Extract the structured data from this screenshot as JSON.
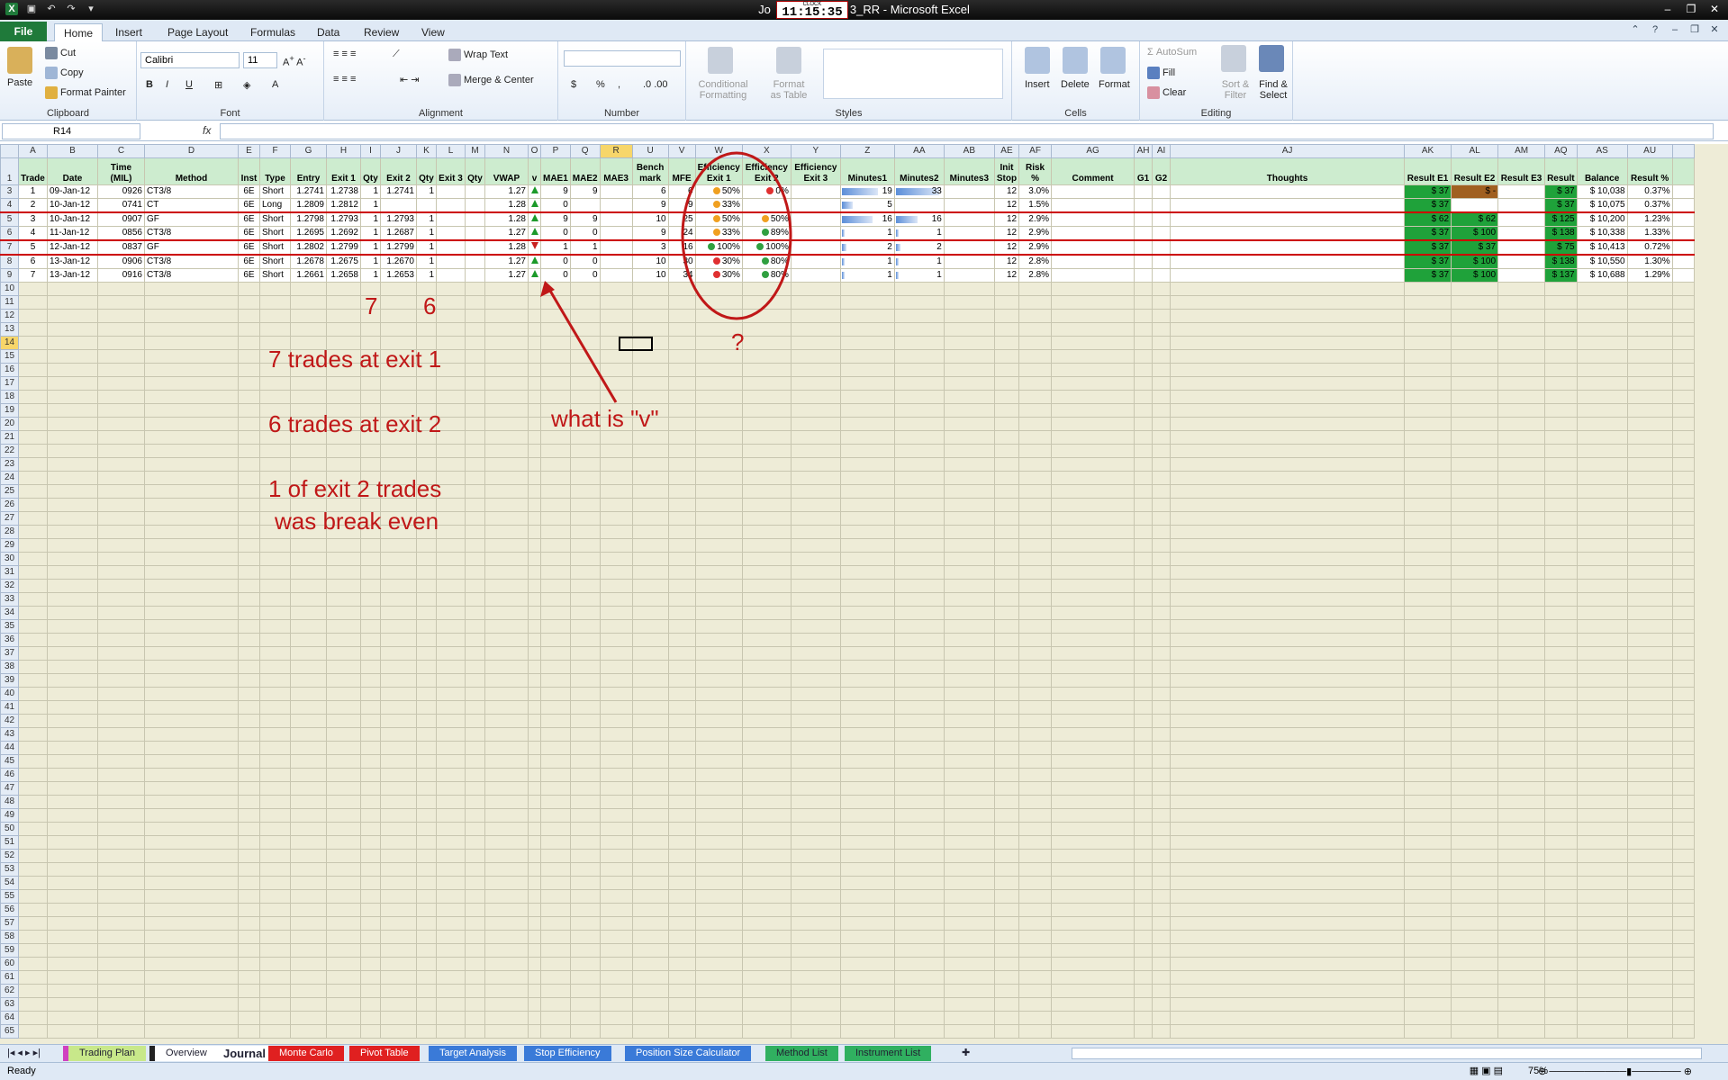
{
  "window": {
    "title_left": "Jo",
    "title_right": "3_RR - Microsoft Excel",
    "clock_label": "CLOCK",
    "clock_time": "11:15:35"
  },
  "ribbon": {
    "tabs": [
      "File",
      "Home",
      "Insert",
      "Page Layout",
      "Formulas",
      "Data",
      "Review",
      "View"
    ],
    "clipboard": {
      "paste": "Paste",
      "cut": "Cut",
      "copy": "Copy",
      "format_painter": "Format Painter",
      "label": "Clipboard"
    },
    "font": {
      "name": "Calibri",
      "size": "11",
      "label": "Font"
    },
    "alignment": {
      "wrap": "Wrap Text",
      "merge": "Merge & Center",
      "label": "Alignment"
    },
    "number": {
      "currency": "$",
      "percent": "%",
      "comma": ",",
      "label": "Number"
    },
    "styles": {
      "cond": "Conditional",
      "cond2": "Formatting",
      "format_table": "Format",
      "format_table2": "as Table",
      "label": "Styles"
    },
    "cells": {
      "insert": "Insert",
      "delete": "Delete",
      "format": "Format",
      "label": "Cells"
    },
    "editing": {
      "autosum": "AutoSum",
      "fill": "Fill",
      "clear": "Clear",
      "sort": "Sort &",
      "sort2": "Filter",
      "find": "Find &",
      "find2": "Select",
      "label": "Editing"
    }
  },
  "formula_bar": {
    "name_box": "R14",
    "fx": "fx",
    "value": ""
  },
  "columns": [
    "A",
    "B",
    "C",
    "D",
    "E",
    "F",
    "G",
    "H",
    "I",
    "J",
    "K",
    "L",
    "M",
    "N",
    "O",
    "P",
    "Q",
    "R",
    "U",
    "V",
    "W",
    "X",
    "Y",
    "Z",
    "AA",
    "AB",
    "AE",
    "AF",
    "AG",
    "AH",
    "AI",
    "AJ",
    "AK",
    "AL",
    "AM",
    "AQ",
    "AS",
    "AU"
  ],
  "headers": [
    "Trade",
    "Date",
    "Time (MIL)",
    "Method",
    "Inst",
    "Type",
    "Entry",
    "Exit 1",
    "Qty",
    "Exit 2",
    "Qty",
    "Exit 3",
    "Qty",
    "VWAP",
    "v",
    "MAE1",
    "MAE2",
    "MAE3",
    "Bench mark",
    "MFE",
    "Efficiency Exit 1",
    "Efficiency Exit 2",
    "Efficiency Exit 3",
    "Minutes1",
    "Minutes2",
    "Minutes3",
    "Init Stop",
    "Risk %",
    "Comment",
    "G1",
    "G2",
    "Thoughts",
    "Result E1",
    "Result E2",
    "Result E3",
    "Result",
    "Balance",
    "Result %"
  ],
  "rows": [
    {
      "n": "3",
      "trade": "1",
      "date": "09-Jan-12",
      "time": "0926",
      "method": "CT3/8",
      "inst": "6E",
      "type": "Short",
      "entry": "1.2741",
      "exit1": "1.2738",
      "qty1": "1",
      "exit2": "1.2741",
      "qty2": "1",
      "vwap": "1.27",
      "v": "up",
      "mae1": "9",
      "mae2": "9",
      "bench": "6",
      "mfe": "6",
      "eff1": "50%",
      "eff1c": "#f0a020",
      "eff2c": "#e03030",
      "eff2": "0%",
      "min1": "19",
      "min1w": 40,
      "min2": "33",
      "min2w": 48,
      "stop": "12",
      "risk": "3.0%",
      "re1": "$     37",
      "re2": "$      -",
      "re2cls": "br",
      "res": "$   37",
      "bal": "$ 10,038",
      "resp": "0.37%",
      "red": false
    },
    {
      "n": "4",
      "trade": "2",
      "date": "10-Jan-12",
      "time": "0741",
      "method": "CT",
      "inst": "6E",
      "type": "Long",
      "entry": "1.2809",
      "exit1": "1.2812",
      "qty1": "1",
      "exit2": "",
      "qty2": "",
      "vwap": "1.28",
      "v": "up",
      "mae1": "0",
      "mae2": "",
      "bench": "9",
      "mfe": "9",
      "eff1": "33%",
      "eff1c": "#f0a020",
      "eff2c": "",
      "eff2": "",
      "min1": "5",
      "min1w": 12,
      "min2": "",
      "min2w": 0,
      "stop": "12",
      "risk": "1.5%",
      "re1": "$     37",
      "re2": "",
      "re2cls": "bl",
      "res": "$   37",
      "bal": "$ 10,075",
      "resp": "0.37%",
      "red": true
    },
    {
      "n": "5",
      "trade": "3",
      "date": "10-Jan-12",
      "time": "0907",
      "method": "GF",
      "inst": "6E",
      "type": "Short",
      "entry": "1.2798",
      "exit1": "1.2793",
      "qty1": "1",
      "exit2": "1.2793",
      "qty2": "1",
      "vwap": "1.28",
      "v": "up",
      "mae1": "9",
      "mae2": "9",
      "bench": "10",
      "mfe": "25",
      "eff1": "50%",
      "eff1c": "#f0a020",
      "eff2c": "#f0a020",
      "eff2": "50%",
      "min1": "16",
      "min1w": 34,
      "min2": "16",
      "min2w": 24,
      "stop": "12",
      "risk": "2.9%",
      "re1": "$     62",
      "re2": "$     62",
      "re2cls": "",
      "res": "$ 125",
      "bal": "$ 10,200",
      "resp": "1.23%",
      "red": false
    },
    {
      "n": "6",
      "trade": "4",
      "date": "11-Jan-12",
      "time": "0856",
      "method": "CT3/8",
      "inst": "6E",
      "type": "Short",
      "entry": "1.2695",
      "exit1": "1.2692",
      "qty1": "1",
      "exit2": "1.2687",
      "qty2": "1",
      "vwap": "1.27",
      "v": "up",
      "mae1": "0",
      "mae2": "0",
      "bench": "9",
      "mfe": "24",
      "eff1": "33%",
      "eff1c": "#f0a020",
      "eff2c": "#30a040",
      "eff2": "89%",
      "min1": "1",
      "min1w": 3,
      "min2": "1",
      "min2w": 3,
      "stop": "12",
      "risk": "2.9%",
      "re1": "$     37",
      "re2": "$   100",
      "re2cls": "",
      "res": "$ 138",
      "bal": "$ 10,338",
      "resp": "1.33%",
      "red": true
    },
    {
      "n": "7",
      "trade": "5",
      "date": "12-Jan-12",
      "time": "0837",
      "method": "GF",
      "inst": "6E",
      "type": "Short",
      "entry": "1.2802",
      "exit1": "1.2799",
      "qty1": "1",
      "exit2": "1.2799",
      "qty2": "1",
      "vwap": "1.28",
      "v": "down",
      "mae1": "1",
      "mae2": "1",
      "bench": "3",
      "mfe": "16",
      "eff1": "100%",
      "eff1c": "#30a040",
      "eff2c": "#30a040",
      "eff2": "100%",
      "min1": "2",
      "min1w": 5,
      "min2": "2",
      "min2w": 5,
      "stop": "12",
      "risk": "2.9%",
      "re1": "$     37",
      "re2": "$     37",
      "re2cls": "",
      "res": "$   75",
      "bal": "$ 10,413",
      "resp": "0.72%",
      "red": true
    },
    {
      "n": "8",
      "trade": "6",
      "date": "13-Jan-12",
      "time": "0906",
      "method": "CT3/8",
      "inst": "6E",
      "type": "Short",
      "entry": "1.2678",
      "exit1": "1.2675",
      "qty1": "1",
      "exit2": "1.2670",
      "qty2": "1",
      "vwap": "1.27",
      "v": "up",
      "mae1": "0",
      "mae2": "0",
      "bench": "10",
      "mfe": "30",
      "eff1": "30%",
      "eff1c": "#e03030",
      "eff2c": "#30a040",
      "eff2": "80%",
      "min1": "1",
      "min1w": 3,
      "min2": "1",
      "min2w": 3,
      "stop": "12",
      "risk": "2.8%",
      "re1": "$     37",
      "re2": "$   100",
      "re2cls": "",
      "res": "$ 138",
      "bal": "$ 10,550",
      "resp": "1.30%",
      "red": false
    },
    {
      "n": "9",
      "trade": "7",
      "date": "13-Jan-12",
      "time": "0916",
      "method": "CT3/8",
      "inst": "6E",
      "type": "Short",
      "entry": "1.2661",
      "exit1": "1.2658",
      "qty1": "1",
      "exit2": "1.2653",
      "qty2": "1",
      "vwap": "1.27",
      "v": "up",
      "mae1": "0",
      "mae2": "0",
      "bench": "10",
      "mfe": "34",
      "eff1": "30%",
      "eff1c": "#e03030",
      "eff2c": "#30a040",
      "eff2": "80%",
      "min1": "1",
      "min1w": 3,
      "min2": "1",
      "min2w": 3,
      "stop": "12",
      "risk": "2.8%",
      "re1": "$     37",
      "re2": "$   100",
      "re2cls": "",
      "res": "$ 137",
      "bal": "$ 10,688",
      "resp": "1.29%",
      "red": false
    }
  ],
  "annotations": {
    "qty1_count": "7",
    "qty2_count": "6",
    "line1": "7 trades at exit 1",
    "line2": "6 trades at exit 2",
    "line3a": "1 of exit 2 trades",
    "line3b": "was break even",
    "v_question": "what is \"v\"",
    "q_mark": "?",
    "accent": "#c01818"
  },
  "sheet_tabs": [
    "Trading Plan",
    "Overview",
    "Journal",
    "Monte Carlo",
    "Pivot Table",
    "Target Analysis",
    "Stop Efficiency",
    "Position Size Calculator",
    "Method List",
    "Instrument List"
  ],
  "status": {
    "ready": "Ready",
    "zoom": "75%"
  }
}
